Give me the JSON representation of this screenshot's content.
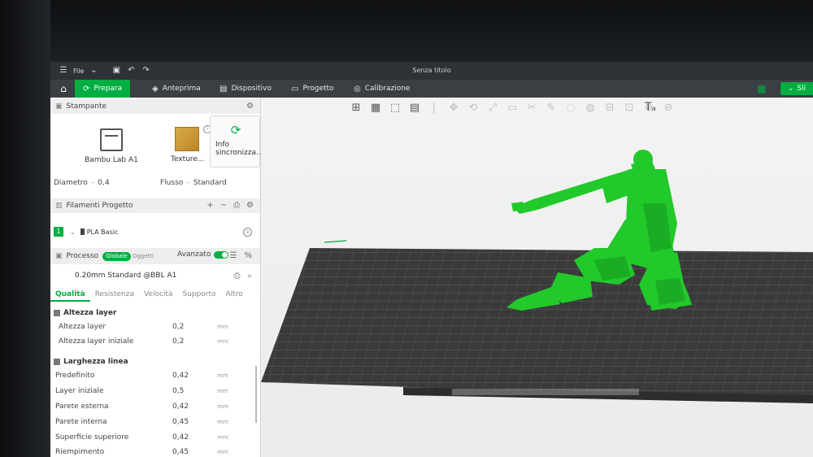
{
  "titlebar": {
    "menu_label": "File",
    "title": "Senza titolo"
  },
  "tabs": [
    {
      "label": "Prepara",
      "icon": "prepare-icon"
    },
    {
      "label": "Anteprima",
      "icon": "cube-icon"
    },
    {
      "label": "Dispositivo",
      "icon": "device-icon"
    },
    {
      "label": "Progetto",
      "icon": "project-icon"
    },
    {
      "label": "Calibrazione",
      "icon": "calibration-icon"
    }
  ],
  "slice_button": {
    "label": "Sli"
  },
  "printer_section": {
    "title": "Stampante",
    "printer_name": "Bambu Lab A1",
    "plate_label": "Texture...",
    "sync_label_1": "Info",
    "sync_label_2": "sincronizza...",
    "diameter_label": "Diametro",
    "diameter_value": "0,4",
    "flow_label": "Flusso",
    "flow_value": "Standard"
  },
  "filament_section": {
    "title": "Filamenti Progetto",
    "slot_number": "1",
    "filament_name": "PLA Basic"
  },
  "process_section": {
    "title": "Processo",
    "badge_global": "Globale",
    "badge_objects": "Oggetti",
    "advanced_label": "Avanzato",
    "advanced_on": true,
    "preset": "0.20mm Standard @BBL A1"
  },
  "subtabs": [
    "Qualità",
    "Resistenza",
    "Velocità",
    "Supporto",
    "Altro"
  ],
  "layer_height_group": {
    "title": "Altezza layer",
    "rows": [
      {
        "label": "Altezza layer",
        "value": "0,2",
        "unit": "mm"
      },
      {
        "label": "Altezza layer iniziale",
        "value": "0,2",
        "unit": "mm"
      }
    ]
  },
  "line_width_group": {
    "title": "Larghezza linea",
    "rows": [
      {
        "label": "Predefinito",
        "value": "0,42",
        "unit": "mm"
      },
      {
        "label": "Layer iniziale",
        "value": "0,5",
        "unit": "mm"
      },
      {
        "label": "Parete esterna",
        "value": "0,42",
        "unit": "mm"
      },
      {
        "label": "Parete interna",
        "value": "0,45",
        "unit": "mm"
      },
      {
        "label": "Superficie superiore",
        "value": "0,42",
        "unit": "mm"
      },
      {
        "label": "Riempimento",
        "value": "0,45",
        "unit": "mm"
      }
    ]
  },
  "colors": {
    "accent": "#00ae42",
    "model": "#22c92a",
    "plate": "#3a3a3a"
  }
}
